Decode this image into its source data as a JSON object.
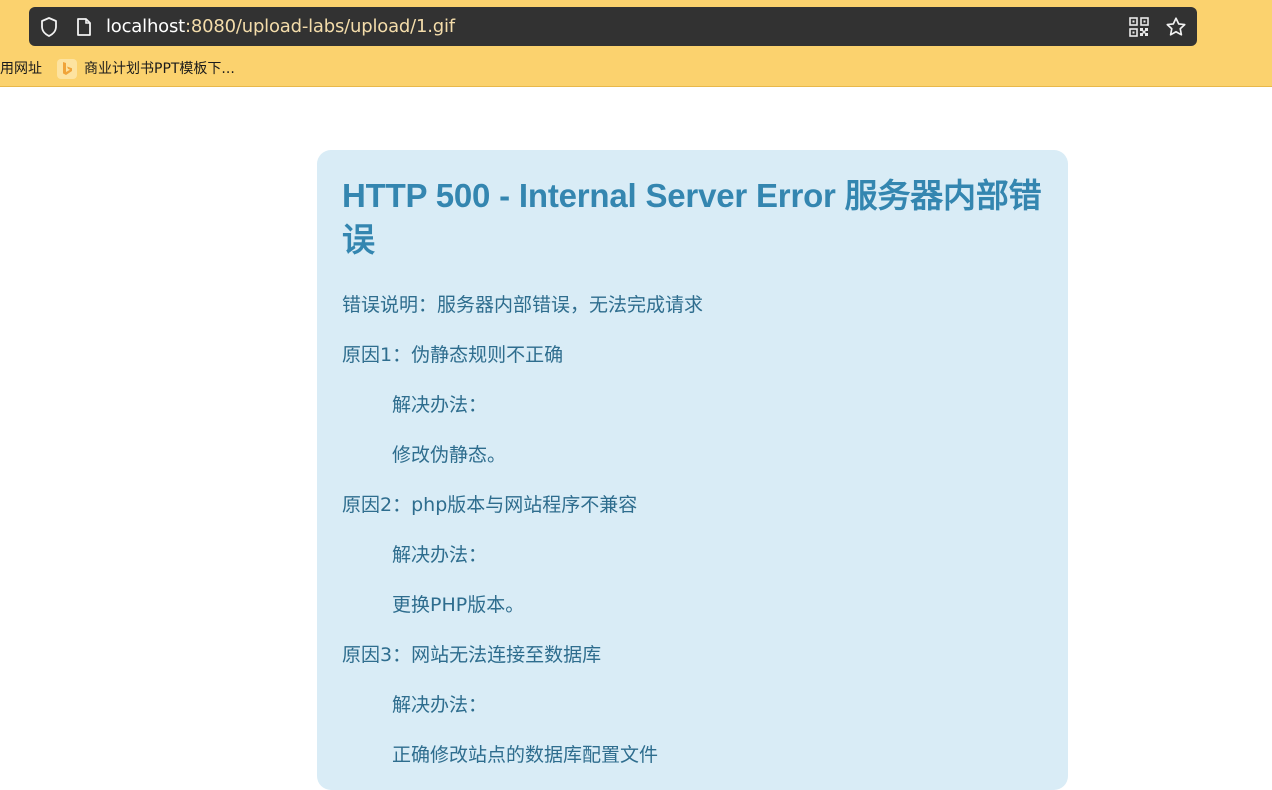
{
  "browser": {
    "url_host": "localhost",
    "url_rest": ":8080/upload-labs/upload/1.gif",
    "bookmarks": [
      "用网址",
      "商业计划书PPT模板下..."
    ],
    "theme_color": "#fbd26e"
  },
  "error_page": {
    "title": "HTTP 500 - Internal Server Error 服务器内部错误",
    "description": "错误说明：服务器内部错误，无法完成请求",
    "reason1": "原因1：伪静态规则不正确",
    "reason1_solution_label": "解决办法：",
    "reason1_solution": "修改伪静态。",
    "reason2": "原因2：php版本与网站程序不兼容",
    "reason2_solution_label": "解决办法：",
    "reason2_solution": "更换PHP版本。",
    "reason3": "原因3：网站无法连接至数据库",
    "reason3_solution_label": "解决办法：",
    "reason3_solution_partial": "正确修改站点的数据库配置文件",
    "title_color": "#3486b0",
    "card_color": "#d9ecf6"
  }
}
